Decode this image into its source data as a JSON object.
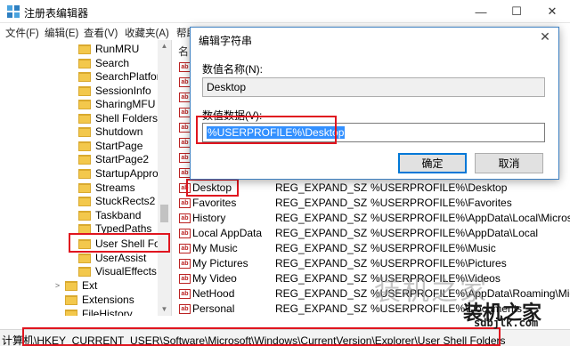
{
  "window": {
    "title": "注册表编辑器",
    "minimize_glyph": "—",
    "maximize_glyph": "☐",
    "close_glyph": "✕"
  },
  "menu": [
    "文件(F)",
    "编辑(E)",
    "查看(V)",
    "收藏夹(A)",
    "帮助"
  ],
  "tree": {
    "items": [
      {
        "label": "RunMRU"
      },
      {
        "label": "Search"
      },
      {
        "label": "SearchPlatforr"
      },
      {
        "label": "SessionInfo"
      },
      {
        "label": "SharingMFU"
      },
      {
        "label": "Shell Folders"
      },
      {
        "label": "Shutdown"
      },
      {
        "label": "StartPage"
      },
      {
        "label": "StartPage2"
      },
      {
        "label": "StartupAppro"
      },
      {
        "label": "Streams"
      },
      {
        "label": "StuckRects2"
      },
      {
        "label": "Taskband"
      },
      {
        "label": "TypedPaths"
      },
      {
        "label": "User Shell Fold"
      },
      {
        "label": "UserAssist"
      },
      {
        "label": "VisualEffects"
      },
      {
        "label": "Ext"
      },
      {
        "label": "Extensions"
      },
      {
        "label": "FileHistory"
      }
    ],
    "expander_collapsed": ">",
    "up_arrow": "▲",
    "down_arrow": "▼"
  },
  "list": {
    "header_name": "名",
    "ab_glyph": "ab",
    "rows": [
      {
        "name": "Desktop",
        "type": "REG_EXPAND_SZ",
        "data": "%USERPROFILE%\\Desktop"
      },
      {
        "name": "Favorites",
        "type": "REG_EXPAND_SZ",
        "data": "%USERPROFILE%\\Favorites"
      },
      {
        "name": "History",
        "type": "REG_EXPAND_SZ",
        "data": "%USERPROFILE%\\AppData\\Local\\Micros"
      },
      {
        "name": "Local AppData",
        "type": "REG_EXPAND_SZ",
        "data": "%USERPROFILE%\\AppData\\Local"
      },
      {
        "name": "My Music",
        "type": "REG_EXPAND_SZ",
        "data": "%USERPROFILE%\\Music"
      },
      {
        "name": "My Pictures",
        "type": "REG_EXPAND_SZ",
        "data": "%USERPROFILE%\\Pictures"
      },
      {
        "name": "My Video",
        "type": "REG_EXPAND_SZ",
        "data": "%USERPROFILE%\\Videos"
      },
      {
        "name": "NetHood",
        "type": "REG_EXPAND_SZ",
        "data": "%USERPROFILE%\\AppData\\Roaming\\Micr"
      },
      {
        "name": "Personal",
        "type": "REG_EXPAND_SZ",
        "data": "%USERPROFILE%\\Documents"
      }
    ]
  },
  "status": {
    "text": "计算机\\HKEY_CURRENT_USER\\Software\\Microsoft\\Windows\\CurrentVersion\\Explorer\\User Shell Folders"
  },
  "dialog": {
    "title": "编辑字符串",
    "close_glyph": "✕",
    "name_label": "数值名称(N):",
    "name_value": "Desktop",
    "data_label": "数值数据(V):",
    "data_value": "%USERPROFILE%\\Desktop",
    "ok_label": "确定",
    "cancel_label": "取消"
  },
  "watermark": {
    "main": "装机之家",
    "logo": "装机之家",
    "url": "sdbjlk.com"
  },
  "colors": {
    "highlight": "#e0151f",
    "selection": "#3390ff",
    "dialog_border": "#3c7fc1"
  }
}
